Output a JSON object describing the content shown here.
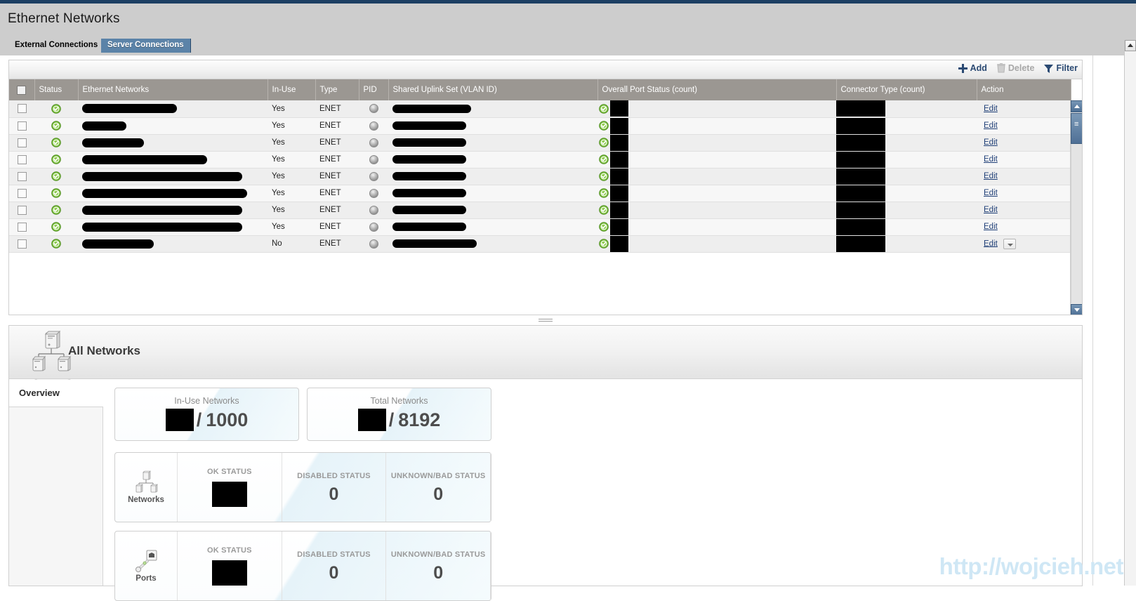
{
  "window": {
    "title": "Ethernet Networks"
  },
  "tabs": [
    {
      "label": "External Connections",
      "active": false
    },
    {
      "label": "Server Connections",
      "active": true
    }
  ],
  "toolbar": {
    "add_label": "Add",
    "delete_label": "Delete",
    "filter_label": "Filter",
    "add_icon": "plus-icon",
    "delete_icon": "trash-icon",
    "filter_icon": "funnel-icon"
  },
  "table": {
    "columns": [
      {
        "key": "select",
        "label": ""
      },
      {
        "key": "status",
        "label": "Status"
      },
      {
        "key": "name",
        "label": "Ethernet Networks"
      },
      {
        "key": "inuse",
        "label": "In-Use"
      },
      {
        "key": "type",
        "label": "Type"
      },
      {
        "key": "pid",
        "label": "PID"
      },
      {
        "key": "sus",
        "label": "Shared Uplink Set (VLAN ID)"
      },
      {
        "key": "ports",
        "label": "Overall Port Status (count)"
      },
      {
        "key": "connector",
        "label": "Connector Type (count)"
      },
      {
        "key": "action",
        "label": "Action"
      }
    ],
    "action_label": "Edit",
    "rows": [
      {
        "status": "ok",
        "name_redacted_width": 135,
        "inuse": "Yes",
        "type": "ENET",
        "pid": "gray-dot",
        "sus_redacted_width": 112,
        "port_status": "ok",
        "port_redacted_width": 26,
        "connector_redacted_width": 70
      },
      {
        "status": "ok",
        "name_redacted_width": 63,
        "inuse": "Yes",
        "type": "ENET",
        "pid": "gray-dot",
        "sus_redacted_width": 105,
        "port_status": "ok",
        "port_redacted_width": 26,
        "connector_redacted_width": 70
      },
      {
        "status": "ok",
        "name_redacted_width": 88,
        "inuse": "Yes",
        "type": "ENET",
        "pid": "gray-dot",
        "sus_redacted_width": 105,
        "port_status": "ok",
        "port_redacted_width": 26,
        "connector_redacted_width": 70
      },
      {
        "status": "ok",
        "name_redacted_width": 178,
        "inuse": "Yes",
        "type": "ENET",
        "pid": "gray-dot",
        "sus_redacted_width": 105,
        "port_status": "ok",
        "port_redacted_width": 26,
        "connector_redacted_width": 70
      },
      {
        "status": "ok",
        "name_redacted_width": 228,
        "inuse": "Yes",
        "type": "ENET",
        "pid": "gray-dot",
        "sus_redacted_width": 105,
        "port_status": "ok",
        "port_redacted_width": 26,
        "connector_redacted_width": 70
      },
      {
        "status": "ok",
        "name_redacted_width": 235,
        "inuse": "Yes",
        "type": "ENET",
        "pid": "gray-dot",
        "sus_redacted_width": 105,
        "port_status": "ok",
        "port_redacted_width": 26,
        "connector_redacted_width": 70
      },
      {
        "status": "ok",
        "name_redacted_width": 228,
        "inuse": "Yes",
        "type": "ENET",
        "pid": "gray-dot",
        "sus_redacted_width": 105,
        "port_status": "ok",
        "port_redacted_width": 26,
        "connector_redacted_width": 70
      },
      {
        "status": "ok",
        "name_redacted_width": 228,
        "inuse": "Yes",
        "type": "ENET",
        "pid": "gray-dot",
        "sus_redacted_width": 105,
        "port_status": "ok",
        "port_redacted_width": 26,
        "connector_redacted_width": 70
      },
      {
        "status": "ok",
        "name_redacted_width": 102,
        "inuse": "No",
        "type": "ENET",
        "pid": "gray-dot",
        "sus_redacted_width": 120,
        "port_status": "ok",
        "port_redacted_width": 26,
        "connector_redacted_width": 70,
        "has_menu": true
      }
    ]
  },
  "detail": {
    "title": "All Networks",
    "icon": "network-topology-icon",
    "vertical_tabs": [
      {
        "label": "Overview",
        "active": true
      }
    ],
    "kpi_cards": [
      {
        "label": "In-Use Networks",
        "value": "[redacted]",
        "separator": "/",
        "total": "1000"
      },
      {
        "label": "Total Networks",
        "value": "[redacted]",
        "separator": "/",
        "total": "8192"
      }
    ],
    "status_cards": [
      {
        "icon": "network-topology-icon",
        "icon_label": "Networks",
        "columns": [
          {
            "title": "OK STATUS",
            "value": "[redacted]",
            "redacted": true
          },
          {
            "title": "DISABLED STATUS",
            "value": "0",
            "redacted": false
          },
          {
            "title": "UNKNOWN/BAD STATUS",
            "value": "0",
            "redacted": false
          }
        ]
      },
      {
        "icon": "port-cable-icon",
        "icon_label": "Ports",
        "columns": [
          {
            "title": "OK STATUS",
            "value": "[redacted]",
            "redacted": true
          },
          {
            "title": "DISABLED STATUS",
            "value": "0",
            "redacted": false
          },
          {
            "title": "UNKNOWN/BAD STATUS",
            "value": "0",
            "redacted": false
          }
        ]
      }
    ]
  },
  "watermark": {
    "text": "http://wojcieh.net"
  },
  "colors": {
    "accent_blue": "#2b4a73",
    "tab_active_bg": "#5b83a8",
    "header_bg": "#cdcdcd",
    "grid_header_bg": "#9b9792",
    "status_ok_green": "#7cb342",
    "link_blue": "#1f3f77",
    "watermark_blue": "#cfe7f5",
    "top_strip": "#1c3f63"
  }
}
